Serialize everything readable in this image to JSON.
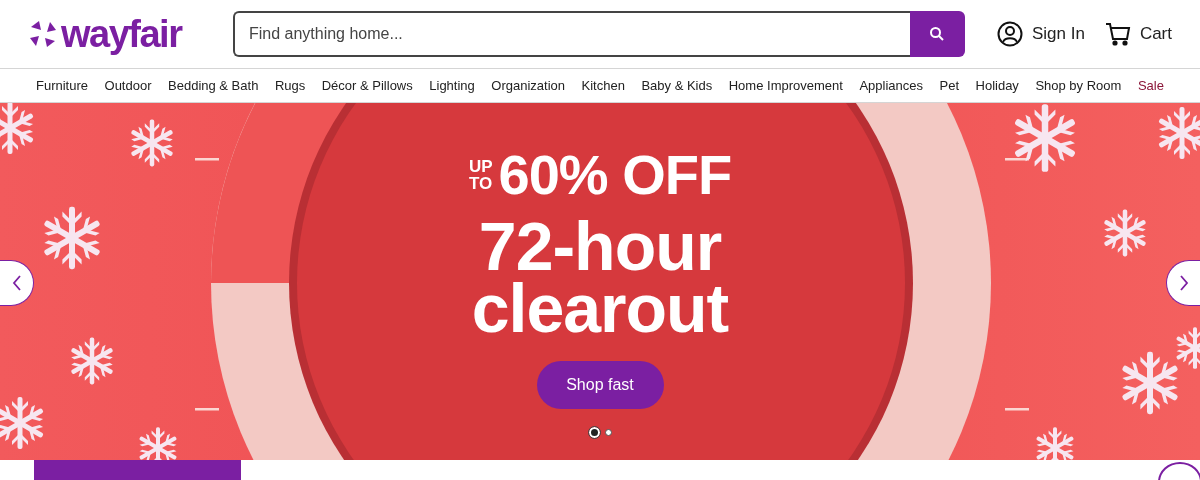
{
  "logo": {
    "text": "wayfair"
  },
  "search": {
    "placeholder": "Find anything home..."
  },
  "account": {
    "label": "Sign In"
  },
  "cart": {
    "label": "Cart"
  },
  "nav": [
    {
      "label": "Furniture",
      "kind": "normal"
    },
    {
      "label": "Outdoor",
      "kind": "normal"
    },
    {
      "label": "Bedding & Bath",
      "kind": "normal"
    },
    {
      "label": "Rugs",
      "kind": "normal"
    },
    {
      "label": "Décor & Pillows",
      "kind": "normal"
    },
    {
      "label": "Lighting",
      "kind": "normal"
    },
    {
      "label": "Organization",
      "kind": "normal"
    },
    {
      "label": "Kitchen",
      "kind": "normal"
    },
    {
      "label": "Baby & Kids",
      "kind": "normal"
    },
    {
      "label": "Home Improvement",
      "kind": "normal"
    },
    {
      "label": "Appliances",
      "kind": "normal"
    },
    {
      "label": "Pet",
      "kind": "normal"
    },
    {
      "label": "Holiday",
      "kind": "normal"
    },
    {
      "label": "Shop by Room",
      "kind": "normal"
    },
    {
      "label": "Sale",
      "kind": "sale"
    }
  ],
  "hero": {
    "kicker_top": "UP",
    "kicker_bottom": "TO",
    "discount": "60% OFF",
    "headline": "72-hour clearout",
    "cta": "Shop fast",
    "slides": [
      {
        "selected": true
      },
      {
        "selected": false
      }
    ]
  }
}
